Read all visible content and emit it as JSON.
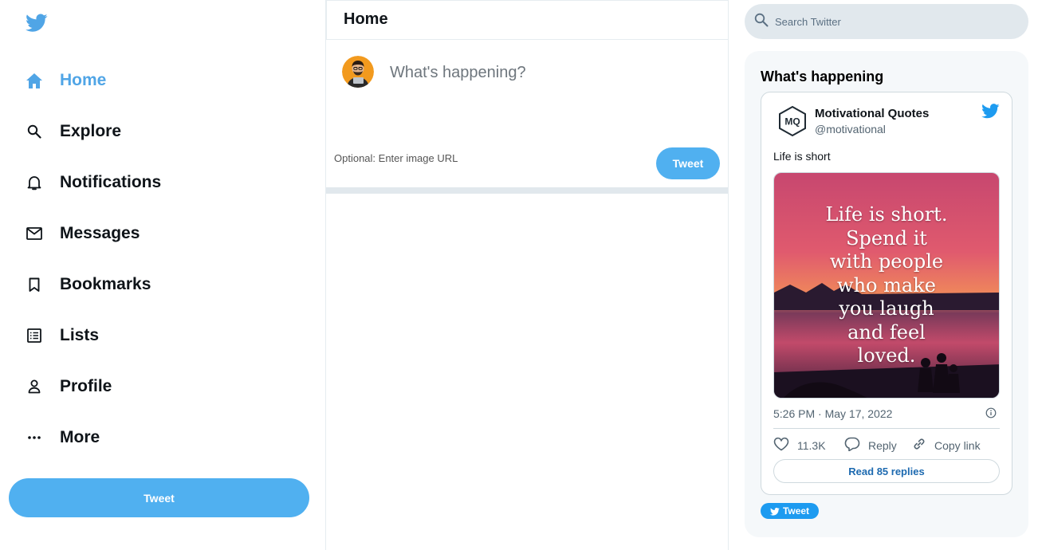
{
  "colors": {
    "brand": "#1d9bf0",
    "button": "#50b0f0",
    "active_nav": "#50a5e6",
    "divider": "#e1e8ed"
  },
  "sidebar": {
    "logo_icon": "twitter-bird-icon",
    "items": [
      {
        "label": "Home",
        "icon": "home-icon",
        "active": true
      },
      {
        "label": "Explore",
        "icon": "search-icon",
        "active": false
      },
      {
        "label": "Notifications",
        "icon": "bell-icon",
        "active": false
      },
      {
        "label": "Messages",
        "icon": "mail-icon",
        "active": false
      },
      {
        "label": "Bookmarks",
        "icon": "bookmark-icon",
        "active": false
      },
      {
        "label": "Lists",
        "icon": "list-icon",
        "active": false
      },
      {
        "label": "Profile",
        "icon": "person-icon",
        "active": false
      },
      {
        "label": "More",
        "icon": "more-dots-icon",
        "active": false
      }
    ],
    "tweet_button": "Tweet"
  },
  "main": {
    "title": "Home",
    "composer": {
      "placeholder": "What's happening?",
      "image_url_placeholder": "Optional: Enter image URL",
      "tweet_button": "Tweet"
    }
  },
  "right": {
    "search_placeholder": "Search Twitter",
    "trends_title": "What's happening",
    "embed": {
      "avatar_text": "MQ",
      "name": "Motivational Quotes",
      "handle": "@motivational",
      "text": "Life is short",
      "image_quote_lines": [
        "Life is short.",
        "Spend it",
        "with people",
        "who make",
        "you laugh",
        "and feel",
        "loved."
      ],
      "timestamp": "5:26 PM · May 17, 2022",
      "likes": "11.3K",
      "reply_label": "Reply",
      "copy_link_label": "Copy link",
      "read_replies": "Read 85 replies"
    },
    "small_tweet_button": "Tweet"
  }
}
